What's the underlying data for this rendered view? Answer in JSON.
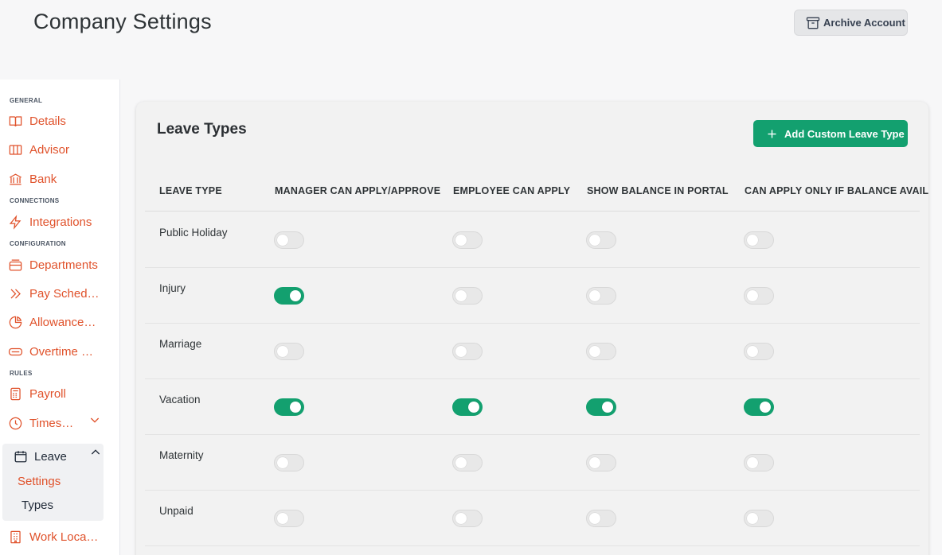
{
  "header": {
    "title": "Company Settings",
    "archive_label": "Archive Account"
  },
  "sidebar": {
    "sections": {
      "general": "GENERAL",
      "connections": "CONNECTIONS",
      "configuration": "CONFIGURATION",
      "rules": "RULES"
    },
    "items": [
      {
        "label": "Details",
        "icon": "book-icon"
      },
      {
        "label": "Advisor",
        "icon": "columns-icon"
      },
      {
        "label": "Bank",
        "icon": "bank-icon"
      },
      {
        "label": "Integrations",
        "icon": "bolt-icon"
      },
      {
        "label": "Departments",
        "icon": "inbox-icon"
      },
      {
        "label": "Pay Schedules",
        "icon": "double-chevron-icon"
      },
      {
        "label": "Allowances & Deductions",
        "icon": "pie-chart-icon"
      },
      {
        "label": "Overtime & Rates",
        "icon": "card-icon"
      },
      {
        "label": "Payroll",
        "icon": "calculator-icon"
      },
      {
        "label": "Timesheets",
        "icon": "clock-icon"
      },
      {
        "label": "Work Locations",
        "icon": "building-icon"
      }
    ],
    "leave": {
      "label": "Leave",
      "sub_items": [
        {
          "label": "Settings",
          "active": true
        },
        {
          "label": "Types",
          "active": false
        }
      ]
    }
  },
  "card": {
    "title": "Leave Types",
    "add_label": "Add Custom Leave Type",
    "columns": [
      "LEAVE TYPE",
      "MANAGER CAN APPLY/APPROVE",
      "EMPLOYEE CAN APPLY",
      "SHOW BALANCE IN PORTAL",
      "CAN APPLY ONLY IF BALANCE AVAILABLE"
    ],
    "rows": [
      {
        "name": "Public Holiday",
        "toggles": [
          false,
          false,
          false,
          false
        ]
      },
      {
        "name": "Injury",
        "toggles": [
          true,
          false,
          false,
          false
        ]
      },
      {
        "name": "Marriage",
        "toggles": [
          false,
          false,
          false,
          false
        ]
      },
      {
        "name": "Vacation",
        "toggles": [
          true,
          true,
          true,
          true
        ]
      },
      {
        "name": "Maternity",
        "toggles": [
          false,
          false,
          false,
          false
        ]
      },
      {
        "name": "Unpaid",
        "toggles": [
          false,
          false,
          false,
          false
        ]
      }
    ]
  },
  "colors": {
    "accent": "#e0522b",
    "toggle_on": "#13a06f",
    "toggle_off": "#e8e8e8"
  }
}
